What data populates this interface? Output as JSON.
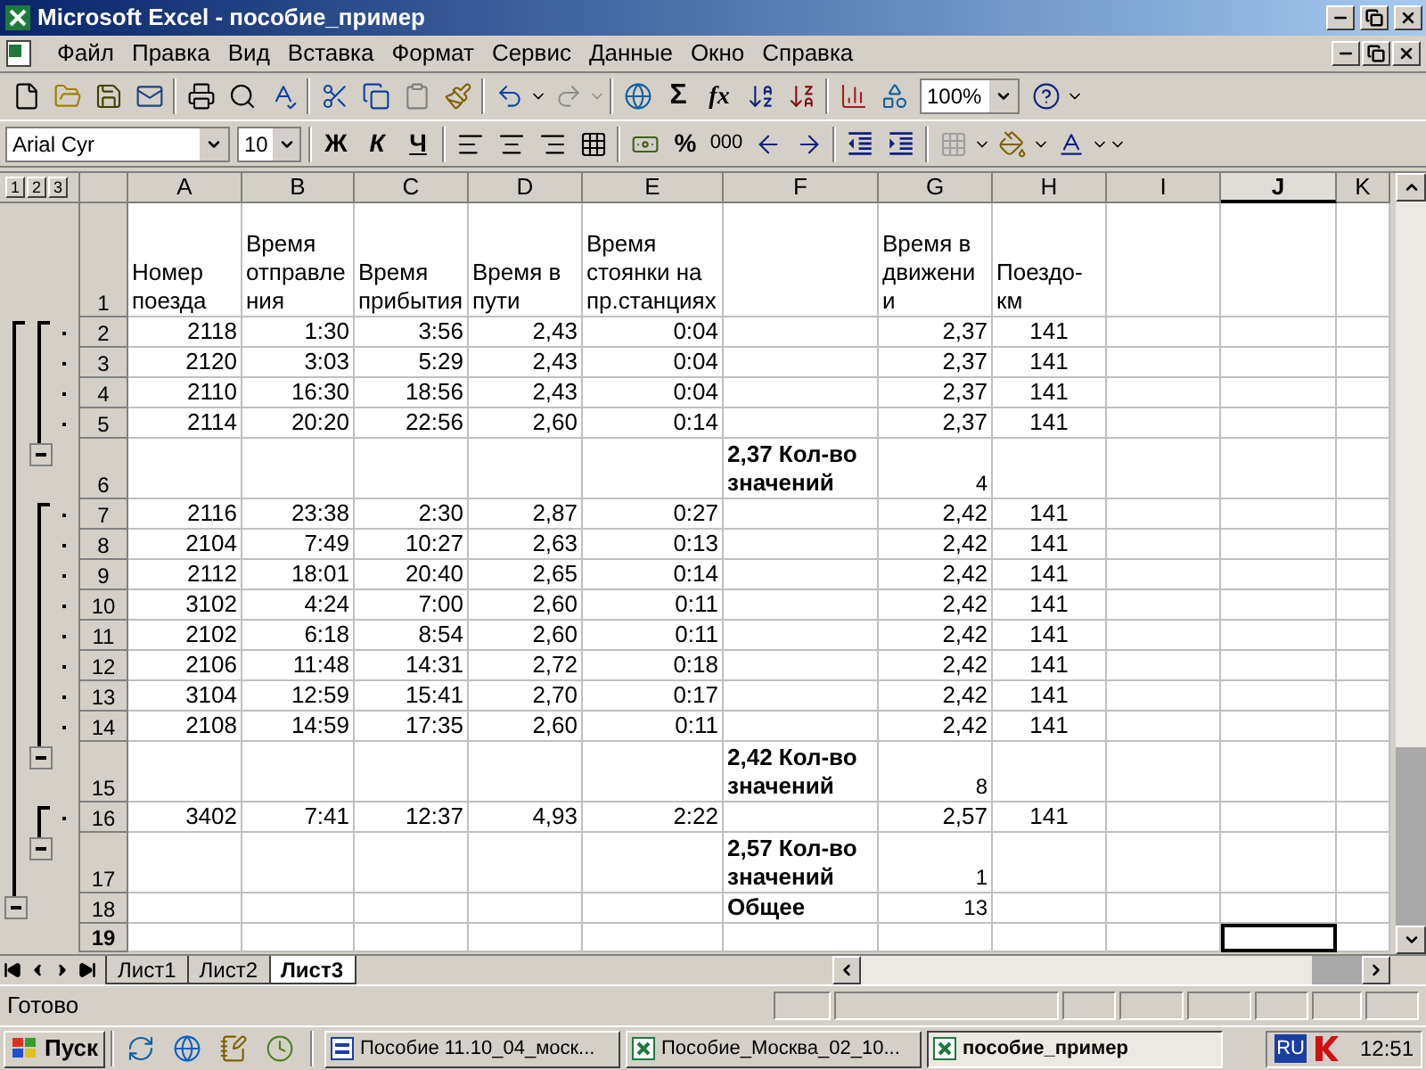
{
  "window": {
    "title": "Microsoft Excel - пособие_пример"
  },
  "menu": [
    "Файл",
    "Правка",
    "Вид",
    "Вставка",
    "Формат",
    "Сервис",
    "Данные",
    "Окно",
    "Справка"
  ],
  "standard_toolbar": {
    "sum": "Σ",
    "function": "fx",
    "zoom": "100%"
  },
  "format_toolbar": {
    "font": "Arial Cyr",
    "size": "10",
    "bold": "Ж",
    "italic": "К",
    "underline": "Ч",
    "percent": "%",
    "thousands": "000"
  },
  "outline_levels": [
    "1",
    "2",
    "3"
  ],
  "columns": [
    {
      "letter": "A",
      "selected": false,
      "heading": "Номер поезда"
    },
    {
      "letter": "B",
      "selected": false,
      "heading": "Время отправления"
    },
    {
      "letter": "C",
      "selected": false,
      "heading": "Время прибытия"
    },
    {
      "letter": "D",
      "selected": false,
      "heading": "Время в пути"
    },
    {
      "letter": "E",
      "selected": false,
      "heading": "Время стоянки на пр.станциях"
    },
    {
      "letter": "F",
      "selected": false
    },
    {
      "letter": "G",
      "selected": false,
      "heading": "Время в движении"
    },
    {
      "letter": "H",
      "selected": false,
      "heading": "Поездо-км"
    },
    {
      "letter": "I",
      "selected": false
    },
    {
      "letter": "J",
      "selected": true
    },
    {
      "letter": "K",
      "selected": false
    }
  ],
  "rows": [
    {
      "number": "1",
      "kind": "header",
      "selected": false
    },
    {
      "number": "2",
      "kind": "data",
      "selected": false,
      "cells": [
        "2118",
        "1:30",
        "3:56",
        "2,43",
        "0:04",
        "2,37",
        "141"
      ]
    },
    {
      "number": "3",
      "kind": "data",
      "selected": false,
      "cells": [
        "2120",
        "3:03",
        "5:29",
        "2,43",
        "0:04",
        "2,37",
        "141"
      ]
    },
    {
      "number": "4",
      "kind": "data",
      "selected": false,
      "cells": [
        "2110",
        "16:30",
        "18:56",
        "2,43",
        "0:04",
        "2,37",
        "141"
      ]
    },
    {
      "number": "5",
      "kind": "data",
      "selected": false,
      "cells": [
        "2114",
        "20:20",
        "22:56",
        "2,60",
        "0:14",
        "2,37",
        "141"
      ]
    },
    {
      "number": "6",
      "kind": "subtotal",
      "selected": false,
      "label": "2,37 Кол-во значений",
      "count": "4"
    },
    {
      "number": "7",
      "kind": "data",
      "selected": false,
      "cells": [
        "2116",
        "23:38",
        "2:30",
        "2,87",
        "0:27",
        "2,42",
        "141"
      ]
    },
    {
      "number": "8",
      "kind": "data",
      "selected": false,
      "cells": [
        "2104",
        "7:49",
        "10:27",
        "2,63",
        "0:13",
        "2,42",
        "141"
      ]
    },
    {
      "number": "9",
      "kind": "data",
      "selected": false,
      "cells": [
        "2112",
        "18:01",
        "20:40",
        "2,65",
        "0:14",
        "2,42",
        "141"
      ]
    },
    {
      "number": "10",
      "kind": "data",
      "selected": false,
      "cells": [
        "3102",
        "4:24",
        "7:00",
        "2,60",
        "0:11",
        "2,42",
        "141"
      ]
    },
    {
      "number": "11",
      "kind": "data",
      "selected": false,
      "cells": [
        "2102",
        "6:18",
        "8:54",
        "2,60",
        "0:11",
        "2,42",
        "141"
      ]
    },
    {
      "number": "12",
      "kind": "data",
      "selected": false,
      "cells": [
        "2106",
        "11:48",
        "14:31",
        "2,72",
        "0:18",
        "2,42",
        "141"
      ]
    },
    {
      "number": "13",
      "kind": "data",
      "selected": false,
      "cells": [
        "3104",
        "12:59",
        "15:41",
        "2,70",
        "0:17",
        "2,42",
        "141"
      ]
    },
    {
      "number": "14",
      "kind": "data",
      "selected": false,
      "cells": [
        "2108",
        "14:59",
        "17:35",
        "2,60",
        "0:11",
        "2,42",
        "141"
      ]
    },
    {
      "number": "15",
      "kind": "subtotal",
      "selected": false,
      "label": "2,42 Кол-во значений",
      "count": "8"
    },
    {
      "number": "16",
      "kind": "data",
      "selected": false,
      "cells": [
        "3402",
        "7:41",
        "12:37",
        "4,93",
        "2:22",
        "2,57",
        "141"
      ]
    },
    {
      "number": "17",
      "kind": "subtotal",
      "selected": false,
      "label": "2,57 Кол-во значений",
      "count": "1"
    },
    {
      "number": "18",
      "kind": "total",
      "selected": false,
      "label": "Общее",
      "count": "13"
    },
    {
      "number": "19",
      "kind": "empty",
      "selected": true
    }
  ],
  "sheet_tabs": [
    {
      "label": "Лист1",
      "selected": false
    },
    {
      "label": "Лист2",
      "selected": false
    },
    {
      "label": "Лист3",
      "selected": true
    }
  ],
  "status_bar": {
    "text": "Готово"
  },
  "taskbar": {
    "start": "Пуск",
    "tasks": [
      {
        "label": "Пособие 11.10_04_моск...",
        "kind": "word",
        "selected": false
      },
      {
        "label": "Пособие_Москва_02_10...",
        "kind": "excel",
        "selected": false
      },
      {
        "label": "пособие_пример",
        "kind": "excel",
        "selected": true
      }
    ],
    "language": "RU",
    "clock": "12:51"
  }
}
